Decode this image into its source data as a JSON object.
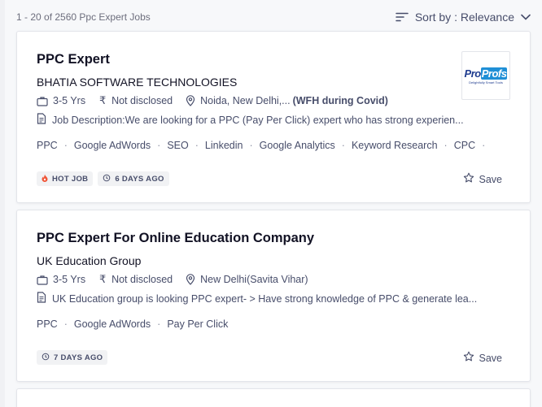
{
  "header": {
    "count": "1 - 20 of 2560  Ppc Expert Jobs",
    "sort_label": "Sort by : Relevance"
  },
  "jobs": [
    {
      "title": "PPC Expert",
      "company": "BHATIA SOFTWARE TECHNOLOGIES",
      "experience": "3-5 Yrs",
      "salary": "Not disclosed",
      "location": "Noida, New Delhi,...",
      "location_note": "(WFH during Covid)",
      "description": "Job Description:We are looking for a PPC (Pay Per Click) expert who has strong experien...",
      "tags": [
        "PPC",
        "Google AdWords",
        "SEO",
        "Linkedin",
        "Google Analytics",
        "Keyword Research",
        "CPC"
      ],
      "hot_badge": "HOT JOB",
      "posted": "6 DAYS AGO",
      "save_label": "Save",
      "logo": {
        "part1": "Pro",
        "part2": "Profs",
        "tagline": "Delightfully Smart Tools"
      }
    },
    {
      "title": "PPC Expert For Online Education Company",
      "company": "UK Education Group",
      "experience": "3-5 Yrs",
      "salary": "Not disclosed",
      "location": "New Delhi(Savita Vihar)",
      "description": "UK Education group is looking PPC expert- > Have strong knowledge of PPC & generate lea...",
      "tags": [
        "PPC",
        "Google AdWords",
        "Pay Per Click"
      ],
      "posted": "7 DAYS AGO",
      "save_label": "Save"
    }
  ],
  "colors": {
    "text": "#121224",
    "muted": "#474d6a",
    "hot": "#f05537",
    "logo_blue": "#1f3c8f"
  }
}
